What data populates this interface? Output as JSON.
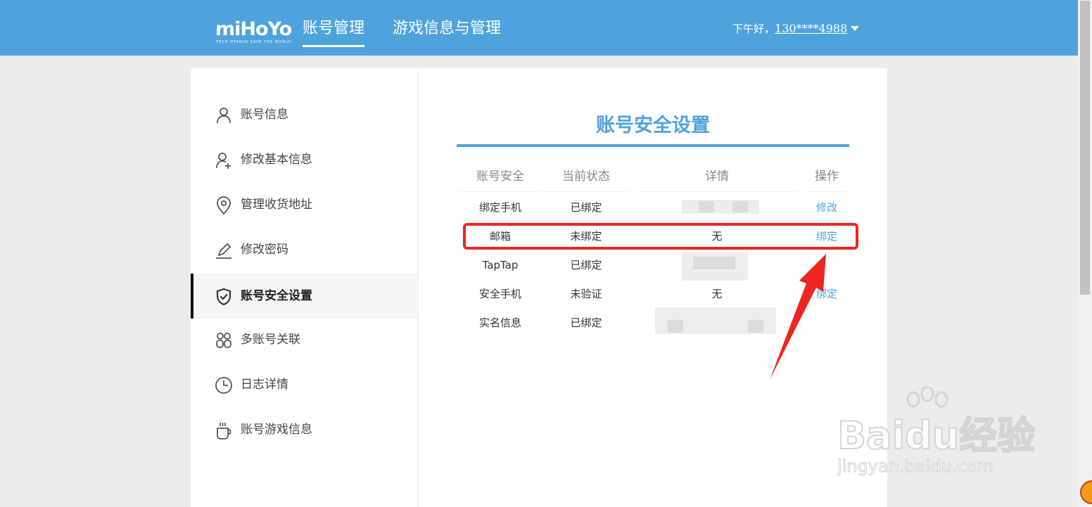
{
  "header": {
    "logo_text": "miHoYo",
    "logo_tagline": "TECH OTAKUS SAVE THE WORLD",
    "tabs": [
      {
        "label": "账号管理",
        "active": true
      },
      {
        "label": "游戏信息与管理",
        "active": false
      }
    ],
    "greeting": "下午好，",
    "username": "130****4988",
    "bg_color": "#4ea3dd"
  },
  "sidebar": {
    "items": [
      {
        "label": "账号信息",
        "icon": "user-icon",
        "active": false
      },
      {
        "label": "修改基本信息",
        "icon": "user-edit-icon",
        "active": false
      },
      {
        "label": "管理收货地址",
        "icon": "location-pin-icon",
        "active": false
      },
      {
        "label": "修改密码",
        "icon": "pencil-icon",
        "active": false
      },
      {
        "label": "账号安全设置",
        "icon": "shield-check-icon",
        "active": true
      },
      {
        "label": "多账号关联",
        "icon": "multi-account-icon",
        "active": false
      },
      {
        "label": "日志详情",
        "icon": "clock-icon",
        "active": false
      },
      {
        "label": "账号游戏信息",
        "icon": "cup-icon",
        "active": false
      }
    ]
  },
  "main": {
    "title": "账号安全设置",
    "table": {
      "headers": [
        "账号安全",
        "当前状态",
        "详情",
        "操作"
      ],
      "rows": [
        {
          "item": "绑定手机",
          "status": "已绑定",
          "detail": "",
          "action": "修改"
        },
        {
          "item": "邮箱",
          "status": "未绑定",
          "detail": "无",
          "action": "绑定"
        },
        {
          "item": "TapTap",
          "status": "已绑定",
          "detail": "",
          "action": ""
        },
        {
          "item": "安全手机",
          "status": "未验证",
          "detail": "无",
          "action": "绑定"
        },
        {
          "item": "实名信息",
          "status": "已绑定",
          "detail": "",
          "action": ""
        }
      ]
    }
  },
  "annotation": {
    "highlight_color": "#ee2420"
  },
  "watermark": {
    "brand": "Baidu经验",
    "url": "jingyan.baidu.com"
  }
}
